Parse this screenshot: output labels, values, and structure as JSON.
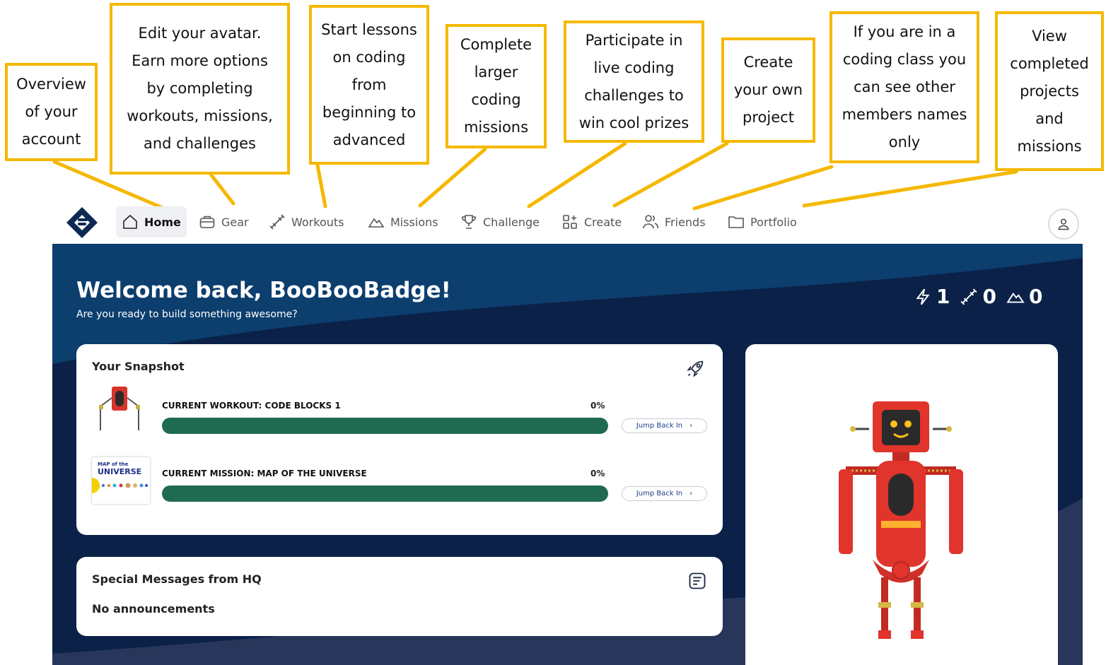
{
  "callouts": [
    {
      "id": "home",
      "text": "Overview\nof your\naccount"
    },
    {
      "id": "gear",
      "text": "Edit your avatar.\nEarn more options\nby completing\nworkouts, missions,\nand challenges"
    },
    {
      "id": "workouts",
      "text": "Start lessons\non coding\nfrom\nbeginning to\nadvanced"
    },
    {
      "id": "missions",
      "text": "Complete\nlarger\ncoding\nmissions"
    },
    {
      "id": "challenge",
      "text": "Participate in\nlive coding\nchallenges to\nwin cool prizes"
    },
    {
      "id": "create",
      "text": "Create\nyour own\nproject"
    },
    {
      "id": "friends",
      "text": "If you are in a\ncoding class you\ncan see other\nmembers names\nonly"
    },
    {
      "id": "portfolio",
      "text": "View\ncompleted\nprojects\nand\nmissions"
    }
  ],
  "nav": {
    "items": [
      {
        "label": "Home",
        "icon": "home-icon",
        "active": true
      },
      {
        "label": "Gear",
        "icon": "briefcase-icon"
      },
      {
        "label": "Workouts",
        "icon": "dumbbell-icon"
      },
      {
        "label": "Missions",
        "icon": "mountain-icon"
      },
      {
        "label": "Challenge",
        "icon": "trophy-icon"
      },
      {
        "label": "Create",
        "icon": "grid-plus-icon"
      },
      {
        "label": "Friends",
        "icon": "users-icon"
      },
      {
        "label": "Portfolio",
        "icon": "folder-icon"
      }
    ],
    "profile_icon": "user-icon"
  },
  "hero": {
    "welcome": "Welcome back, BooBooBadge!",
    "subtitle": "Are you ready to build something awesome?",
    "stats": [
      {
        "icon": "lightning-icon",
        "value": "1"
      },
      {
        "icon": "dumbbell-icon",
        "value": "0"
      },
      {
        "icon": "mountain-icon",
        "value": "0"
      }
    ]
  },
  "snapshot": {
    "title": "Your Snapshot",
    "icon": "rocket-icon",
    "rows": [
      {
        "label": "CURRENT WORKOUT: CODE BLOCKS 1",
        "percent": "0%",
        "progress": 0,
        "button": "Jump Back In",
        "thumb": "robot-thumbnail"
      },
      {
        "label": "CURRENT MISSION: MAP OF THE UNIVERSE",
        "percent": "0%",
        "progress": 0,
        "button": "Jump Back In",
        "thumb": "map-of-the-universe-thumbnail",
        "thumb_text": {
          "small": "MAP of the",
          "big": "UNIVERSE"
        }
      }
    ]
  },
  "messages": {
    "title": "Special Messages from HQ",
    "icon": "note-icon",
    "empty_text": "No announcements"
  },
  "colors": {
    "accent": "#f5b800",
    "hero_bg": "#0c3e6e",
    "hero_dark": "#0b2148",
    "progress": "#1f6b52",
    "robot": "#e0342c"
  }
}
